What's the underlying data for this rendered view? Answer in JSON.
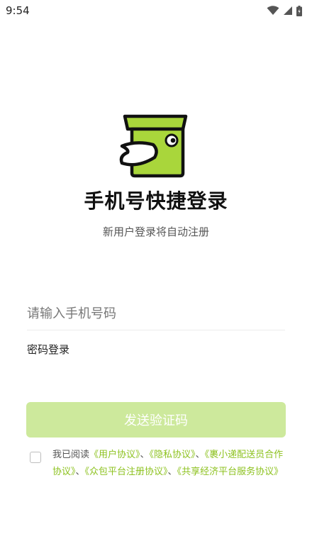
{
  "status_bar": {
    "time": "9:54"
  },
  "app": {
    "title": "手机号快捷登录",
    "subtitle": "新用户登录将自动注册",
    "brand_color": "#a9d63b"
  },
  "form": {
    "phone_placeholder": "请输入手机号码",
    "phone_value": "",
    "password_login": "密码登录",
    "send_code_button": "发送验证码",
    "button_color": "#cde99c"
  },
  "agreement": {
    "checked": false,
    "prefix": "我已阅读",
    "separator": "、",
    "links": [
      "《用户协议》",
      "《隐私协议》",
      "《裹小递配送员合作协议》",
      "《众包平台注册协议》",
      "《共享经济平台服务协议》"
    ],
    "link_color": "#8dc21f"
  }
}
